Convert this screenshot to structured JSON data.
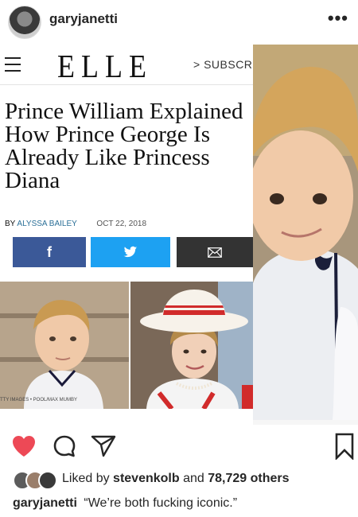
{
  "post": {
    "username": "garyjanetti",
    "more_icon": "more-horizontal-icon"
  },
  "article": {
    "logo": "ELLE",
    "subscribe": "> SUBSCRIBE",
    "headline": "Prince William Explained How Prince George Is Already Like Princess Diana",
    "byline_prefix": "BY",
    "author": "ALYSSA BAILEY",
    "date": "OCT 22, 2018",
    "share": {
      "facebook_label": "f",
      "twitter_icon": "twitter-bird-icon",
      "email_icon": "envelope-icon",
      "colors": {
        "facebook": "#3b5998",
        "twitter": "#1da1f2",
        "email": "#333333"
      }
    },
    "photo_credit": "TTY IMAGES • POOL/MAX MUMBY"
  },
  "actions": {
    "like_icon": "heart-filled-icon",
    "comment_icon": "comment-icon",
    "share_icon": "send-icon",
    "save_icon": "bookmark-icon",
    "like_color": "#ed4956"
  },
  "likes": {
    "prefix": "Liked by",
    "user": "stevenkolb",
    "middle": "and",
    "count": "78,729 others"
  },
  "caption": {
    "username": "garyjanetti",
    "text": "“We’re both fucking iconic.”"
  }
}
